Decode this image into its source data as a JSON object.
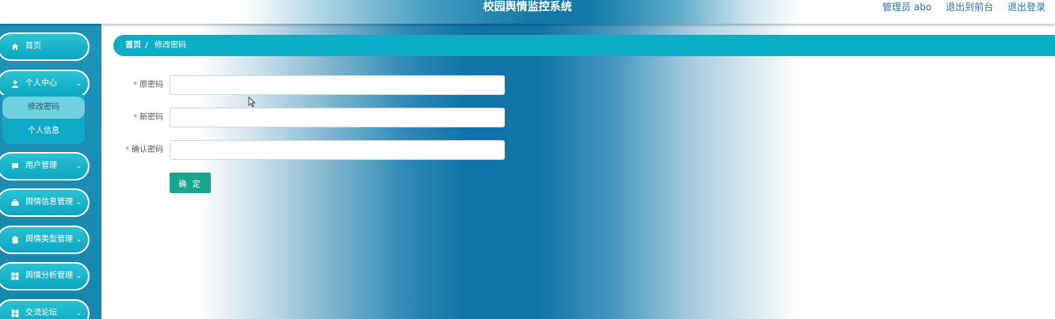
{
  "header": {
    "title": "校园舆情监控系统",
    "user_label": "管理员 abo",
    "front_link": "退出到前台",
    "logout_link": "退出登录"
  },
  "sidebar": {
    "items": [
      {
        "label": "首页",
        "icon": "home-icon",
        "has_chevron": false
      },
      {
        "label": "个人中心",
        "icon": "user-icon",
        "has_chevron": true,
        "chevron": "⌄"
      },
      {
        "label": "用户管理",
        "icon": "chat-icon",
        "has_chevron": true,
        "chevron": "⌄"
      },
      {
        "label": "舆情信息管理",
        "icon": "briefcase-icon",
        "has_chevron": true,
        "chevron": "⌄"
      },
      {
        "label": "舆情类型管理",
        "icon": "clipboard-icon",
        "has_chevron": true,
        "chevron": "⌄"
      },
      {
        "label": "舆情分析管理",
        "icon": "grid-icon",
        "has_chevron": true,
        "chevron": "⌄"
      },
      {
        "label": "交流论坛",
        "icon": "grid-icon",
        "has_chevron": true,
        "chevron": "⌄"
      }
    ],
    "submenu": [
      {
        "label": "修改密码",
        "active": true
      },
      {
        "label": "个人信息",
        "active": false
      }
    ]
  },
  "breadcrumb": {
    "home": "首页",
    "separator": "/",
    "current": "修改密码"
  },
  "form": {
    "required_mark": "*",
    "fields": [
      {
        "label": "原密码",
        "value": "",
        "placeholder": ""
      },
      {
        "label": "新密码",
        "value": "",
        "placeholder": ""
      },
      {
        "label": "确认密码",
        "value": "",
        "placeholder": ""
      }
    ],
    "submit_label": "确 定"
  },
  "colors": {
    "accent": "#0aaec6",
    "sidebar": "#1886ae",
    "button": "#1aa58f",
    "required": "#e05b5b"
  }
}
